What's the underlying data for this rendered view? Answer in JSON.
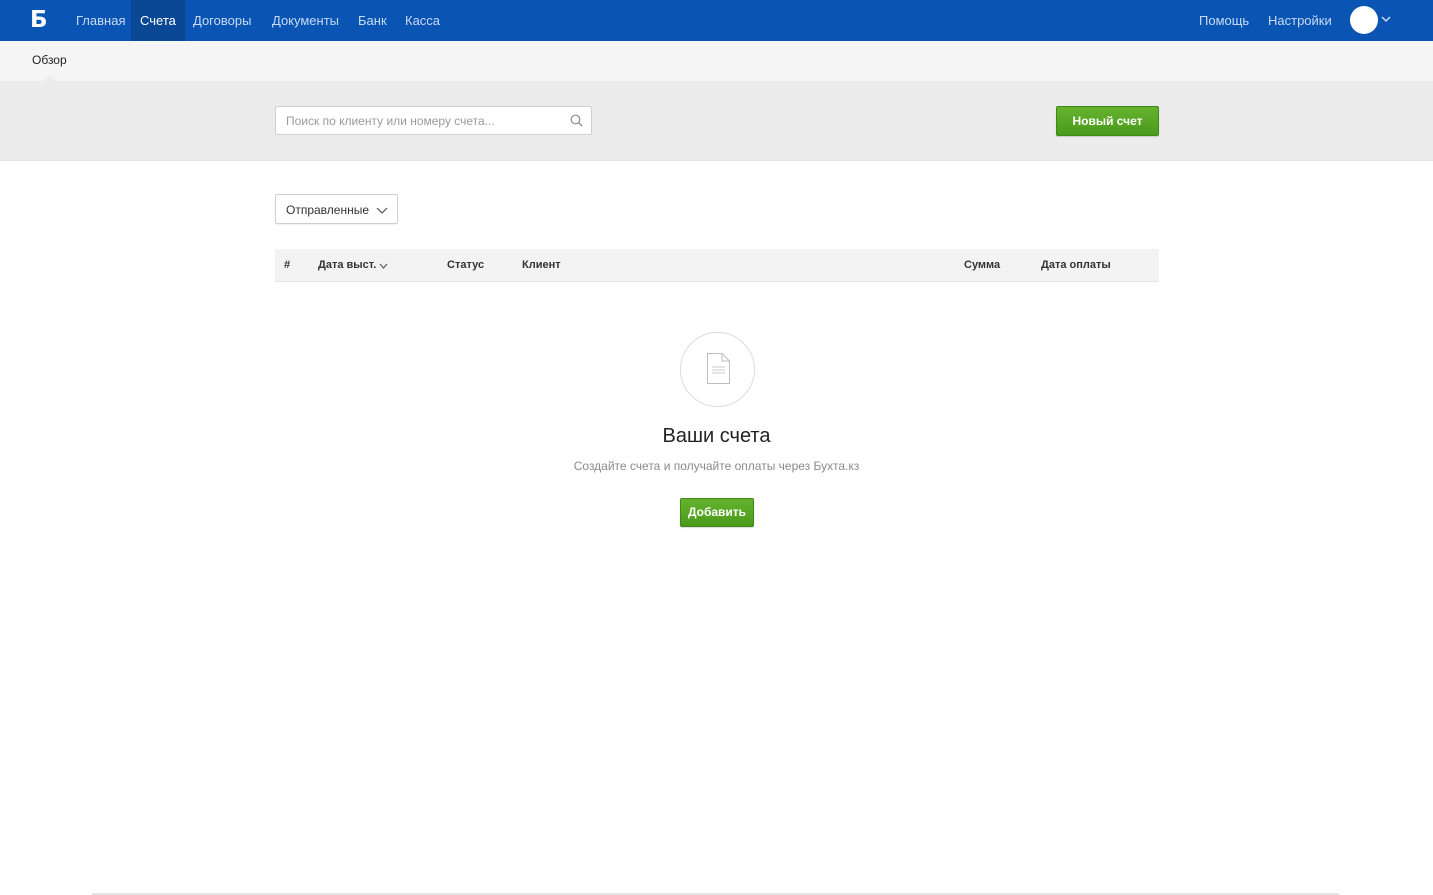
{
  "app": {
    "logo_text": "Б",
    "brand_color": "#0a55b3",
    "accent_green": "#5aaa24"
  },
  "nav": {
    "items": [
      {
        "label": "Главная"
      },
      {
        "label": "Счета",
        "active": true
      },
      {
        "label": "Договоры"
      },
      {
        "label": "Документы"
      },
      {
        "label": "Банк"
      },
      {
        "label": "Касса"
      }
    ],
    "right_items": [
      {
        "label": "Помощь"
      },
      {
        "label": "Настройки"
      }
    ],
    "avatar_icon": "user-avatar-icon"
  },
  "subnav": {
    "tab_label": "Обзор"
  },
  "toolbar": {
    "search_placeholder": "Поиск по клиенту или номеру счета...",
    "search_value": "",
    "search_icon": "search-icon",
    "new_invoice_label": "Новый счет"
  },
  "filter": {
    "selected": "Отправленные"
  },
  "table": {
    "columns": [
      {
        "label": "#"
      },
      {
        "label": "Дата выст.",
        "sorted": true
      },
      {
        "label": "Статус"
      },
      {
        "label": "Клиент"
      },
      {
        "label": "Сумма"
      },
      {
        "label": "Дата оплаты"
      }
    ],
    "rows": []
  },
  "empty_state": {
    "icon": "document-icon",
    "title": "Ваши счета",
    "subtitle": "Создайте счета и получайте оплаты через Бухта.кз",
    "button_label": "Добавить"
  }
}
